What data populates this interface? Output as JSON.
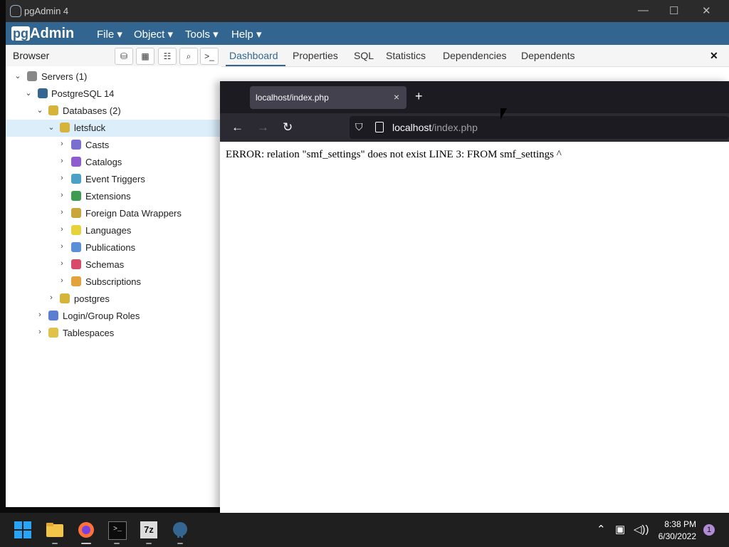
{
  "pgadmin": {
    "window_title": "pgAdmin 4",
    "window_controls": [
      "—",
      "☐",
      "✕"
    ],
    "logo_prefix": "pg",
    "logo_suffix": "Admin",
    "menu": [
      "File ▾",
      "Object ▾",
      "Tools ▾",
      "Help ▾"
    ],
    "browser_label": "Browser",
    "toolbar_icons": [
      "database-icon",
      "table-icon",
      "filter-icon",
      "search-icon",
      "terminal-icon"
    ],
    "tabs": [
      "Dashboard",
      "Properties",
      "SQL",
      "Statistics",
      "Dependencies",
      "Dependents"
    ],
    "active_tab": "Dashboard",
    "close_glyph": "✕",
    "tree": [
      {
        "label": "Servers (1)",
        "icon": "servers-icon",
        "color": "#888888"
      },
      {
        "label": "PostgreSQL 14",
        "icon": "elephant-icon",
        "color": "#336791"
      },
      {
        "label": "Databases (2)",
        "icon": "databases-icon",
        "color": "#d6b43c"
      },
      {
        "label": "letsfuck",
        "icon": "database-icon",
        "color": "#d6b43c"
      },
      {
        "label": "Casts",
        "icon": "casts-icon",
        "color": "#7a6fd1"
      },
      {
        "label": "Catalogs",
        "icon": "catalogs-icon",
        "color": "#8e5ccf"
      },
      {
        "label": "Event Triggers",
        "icon": "event-triggers-icon",
        "color": "#4aa0c6"
      },
      {
        "label": "Extensions",
        "icon": "extensions-icon",
        "color": "#3f9a52"
      },
      {
        "label": "Foreign Data Wrappers",
        "icon": "fdw-icon",
        "color": "#c9a63b"
      },
      {
        "label": "Languages",
        "icon": "languages-icon",
        "color": "#e6d23a"
      },
      {
        "label": "Publications",
        "icon": "publications-icon",
        "color": "#5a8fd8"
      },
      {
        "label": "Schemas",
        "icon": "schemas-icon",
        "color": "#d94a6a"
      },
      {
        "label": "Subscriptions",
        "icon": "subscriptions-icon",
        "color": "#e2a33d"
      },
      {
        "label": "postgres",
        "icon": "database-icon",
        "color": "#d6b43c"
      },
      {
        "label": "Login/Group Roles",
        "icon": "roles-icon",
        "color": "#5b7fd0"
      },
      {
        "label": "Tablespaces",
        "icon": "tablespaces-icon",
        "color": "#e0c24a"
      }
    ]
  },
  "firefox": {
    "tab_title": "localhost/index.php",
    "tab_close": "×",
    "new_tab": "+",
    "url_host": "localhost",
    "url_path": "/index.php",
    "error_text": "ERROR: relation \"smf_settings\" does not exist LINE 3: FROM smf_settings ^"
  },
  "taskbar": {
    "apps": [
      "start-icon",
      "file-explorer-icon",
      "firefox-icon",
      "terminal-icon",
      "7zip-icon",
      "pgadmin-icon"
    ],
    "seven_zip_label": "7z",
    "terminal_label": ">_",
    "time": "8:38 PM",
    "date": "6/30/2022",
    "notification_count": "1"
  },
  "colors": {
    "pgadmin_blue": "#326690",
    "selected_row": "#dbeefa",
    "firefox_dark": "#1c1b22"
  }
}
